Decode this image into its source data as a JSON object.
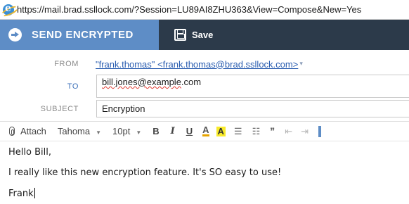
{
  "browser": {
    "url": "https://mail.brad.ssllock.com/?Session=LU89AI8ZHU363&View=Compose&New=Yes"
  },
  "toolbar": {
    "send_label": "SEND ENCRYPTED",
    "save_label": "Save",
    "colors": {
      "bar": "#2c3a4a",
      "send_button": "#5e8dc6"
    }
  },
  "compose": {
    "from_label": "FROM",
    "from_value": "\"frank.thomas\" <frank.thomas@brad.ssllock.com>",
    "to_label": "TO",
    "to_value_user": "bill.jones@example",
    "to_value_tld": ".com",
    "subject_label": "SUBJECT",
    "subject_value": "Encryption"
  },
  "editor_toolbar": {
    "attach_label": "Attach",
    "font_family": "Tahoma",
    "font_size": "10pt",
    "bold": "B",
    "italic": "I",
    "underline": "U",
    "font_color": "A",
    "highlight": "A",
    "icons": [
      "paperclip-icon",
      "numbered-list-icon",
      "bullet-list-icon",
      "quote-icon",
      "outdent-icon",
      "indent-icon"
    ]
  },
  "body": {
    "greeting": "Hello Bill,",
    "message": "I really like this new encryption feature. It's SO easy to use!",
    "signature": "Frank"
  }
}
